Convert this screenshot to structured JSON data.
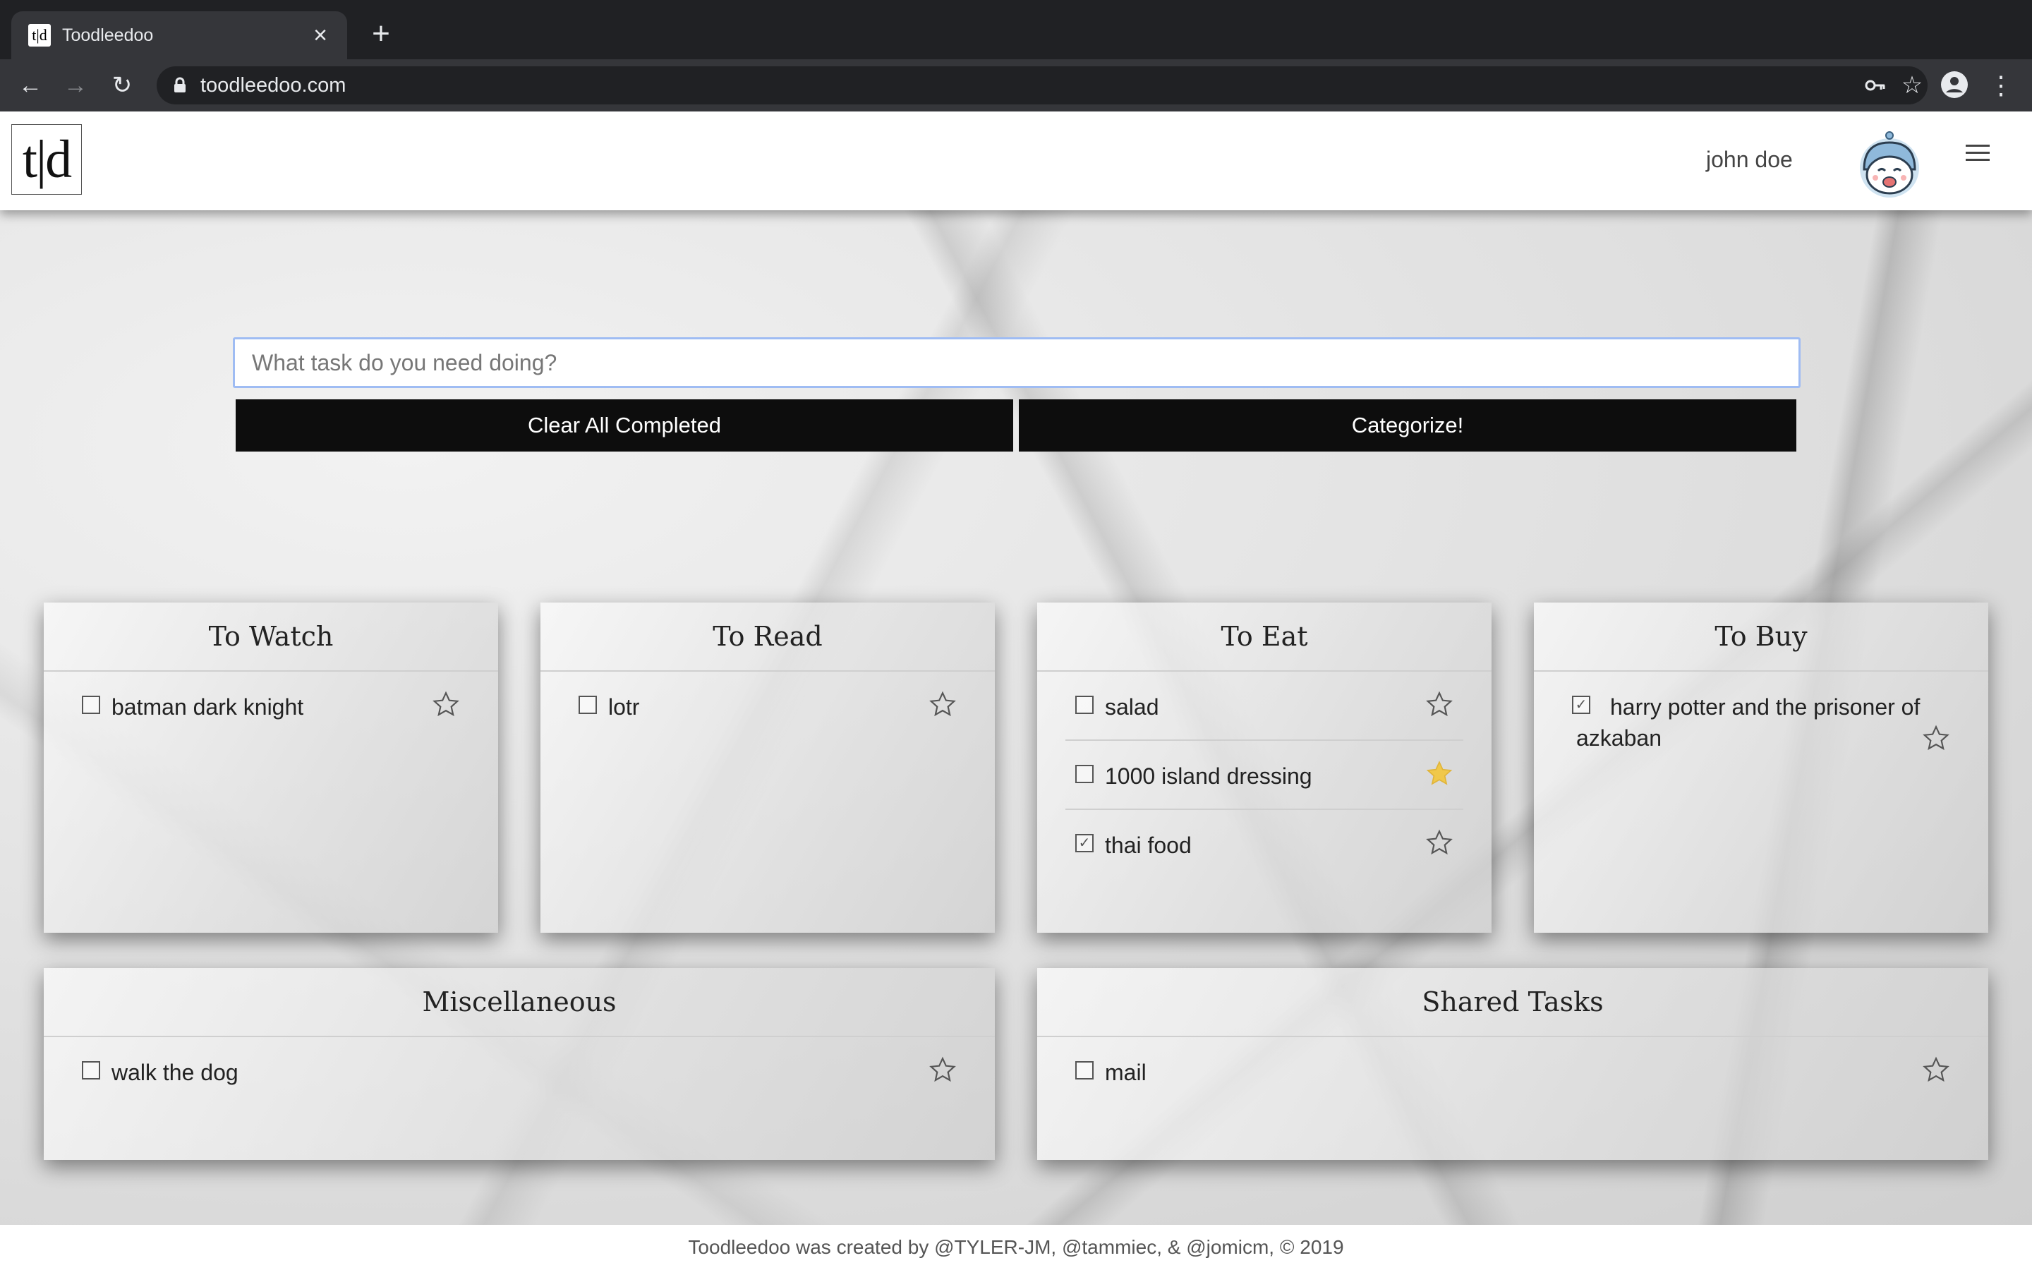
{
  "browser": {
    "tab_title": "Toodleedoo",
    "tab_favicon": "t|d",
    "url": "toodleedoo.com",
    "icons": [
      "back-arrow-icon",
      "forward-arrow-icon",
      "reload-icon",
      "lock-icon",
      "key-icon",
      "star-icon",
      "profile-icon",
      "menu-dots-icon"
    ]
  },
  "header": {
    "logo": "t|d",
    "user_name": "john doe"
  },
  "input": {
    "placeholder": "What task do you need doing?",
    "value": ""
  },
  "buttons": {
    "clear": "Clear All Completed",
    "categorize": "Categorize!"
  },
  "lists": [
    {
      "title": "To Watch",
      "items": [
        {
          "text": "batman dark knight",
          "done": false,
          "starred": false
        }
      ]
    },
    {
      "title": "To Read",
      "items": [
        {
          "text": "lotr",
          "done": false,
          "starred": false
        }
      ]
    },
    {
      "title": "To Eat",
      "items": [
        {
          "text": "salad",
          "done": false,
          "starred": false
        },
        {
          "text": "1000 island dressing",
          "done": false,
          "starred": true
        },
        {
          "text": "thai food",
          "done": true,
          "starred": false
        }
      ]
    },
    {
      "title": "To Buy",
      "items": [
        {
          "text": "harry potter and the prisoner of azkaban",
          "done": true,
          "starred": false
        }
      ]
    },
    {
      "title": "Miscellaneous",
      "items": [
        {
          "text": "walk the dog",
          "done": false,
          "starred": false
        }
      ]
    },
    {
      "title": "Shared Tasks",
      "items": [
        {
          "text": "mail",
          "done": false,
          "starred": false
        }
      ]
    }
  ],
  "colors": {
    "star_active": "#f0c84a",
    "star_inactive": "#555555",
    "button_bg": "#0d0d0d",
    "input_border": "#9fbcf3"
  },
  "footer": {
    "text": "Toodleedoo was created by @TYLER-JM, @tammiec, & @jomicm, © 2019"
  }
}
